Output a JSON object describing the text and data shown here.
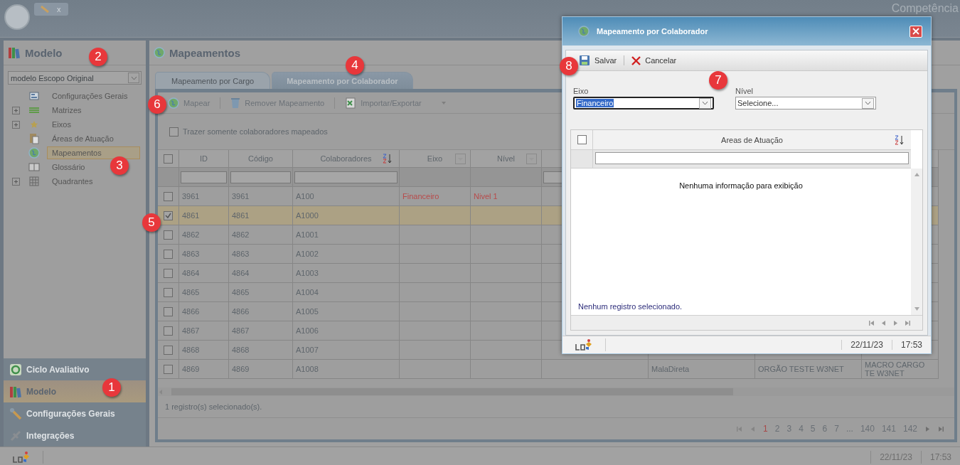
{
  "top_bar": {
    "tab_close": "x",
    "title": "Competência"
  },
  "sidebar": {
    "title": "Modelo",
    "model_select": {
      "value": "modelo Escopo Original"
    },
    "tree": [
      {
        "label": "Configurações Gerais",
        "kind": "leaf",
        "selected": false
      },
      {
        "label": "Matrizes",
        "kind": "folder",
        "selected": false
      },
      {
        "label": "Eixos",
        "kind": "folder",
        "selected": false
      },
      {
        "label": "Áreas de Atuação",
        "kind": "leaf",
        "selected": false
      },
      {
        "label": "Mapeamentos",
        "kind": "leaf",
        "selected": true
      },
      {
        "label": "Glossário",
        "kind": "leaf",
        "selected": false
      },
      {
        "label": "Quadrantes",
        "kind": "folder",
        "selected": false
      }
    ],
    "modules": [
      {
        "label": "Ciclo Avaliativo",
        "selected": false
      },
      {
        "label": "Modelo",
        "selected": true
      },
      {
        "label": "Configurações Gerais",
        "selected": false
      },
      {
        "label": "Integrações",
        "selected": false
      }
    ]
  },
  "main": {
    "title": "Mapeamentos",
    "tabs": [
      {
        "label": "Mapeamento por Cargo",
        "selected": false
      },
      {
        "label": "Mapeamento por Colaborador",
        "selected": true
      }
    ],
    "toolbar": [
      {
        "label": "Mapear",
        "kind": "button"
      },
      {
        "label": "Remover Mapeamento",
        "kind": "button"
      },
      {
        "label": "Importar/Exportar",
        "kind": "menu"
      }
    ],
    "only_mapped": {
      "label": "Trazer somente colaboradores mapeados",
      "checked": false
    },
    "table": {
      "select_all": {
        "checked": false
      },
      "columns": [
        {
          "label": "ID",
          "kind": "text"
        },
        {
          "label": "Código",
          "kind": "text"
        },
        {
          "label": "Colaboradores",
          "kind": "sorted"
        },
        {
          "label": "Eixo",
          "kind": "choice"
        },
        {
          "label": "Nível",
          "kind": "choice"
        },
        {
          "kind": "text"
        },
        {
          "kind": "plain"
        },
        {
          "kind": "plain"
        },
        {
          "kind": "plain"
        }
      ],
      "rows": [
        {
          "cells": [
            "3961",
            "3961",
            "A100",
            "Financeiro",
            "Nivel 1"
          ],
          "checked": false,
          "selected": false
        },
        {
          "cells": [
            "4861",
            "4861",
            "A1000"
          ],
          "checked": true,
          "selected": true
        },
        {
          "cells": [
            "4862",
            "4862",
            "A1001"
          ],
          "checked": false,
          "selected": false
        },
        {
          "cells": [
            "4863",
            "4863",
            "A1002"
          ],
          "checked": false,
          "selected": false
        },
        {
          "cells": [
            "4864",
            "4864",
            "A1003"
          ],
          "checked": false,
          "selected": false
        },
        {
          "cells": [
            "4865",
            "4865",
            "A1004"
          ],
          "checked": false,
          "selected": false
        },
        {
          "cells": [
            "4866",
            "4866",
            "A1005"
          ],
          "checked": false,
          "selected": false
        },
        {
          "cells": [
            "4867",
            "4867",
            "A1006"
          ],
          "checked": false,
          "selected": false
        },
        {
          "cells": [
            "4868",
            "4868",
            "A1007"
          ],
          "checked": false,
          "selected": false
        },
        {
          "cells": [
            "4869",
            "4869",
            "A1008",
            "",
            "",
            "",
            "MalaDireta",
            "ORGÃO TESTE W3NET",
            "MACRO CARGO TE W3NET"
          ],
          "checked": false,
          "selected": false
        }
      ]
    },
    "status": "1 registro(s) selecionado(s).",
    "pages": [
      {
        "label": "1",
        "selected": true
      },
      {
        "label": "2",
        "selected": false
      },
      {
        "label": "3",
        "selected": false
      },
      {
        "label": "4",
        "selected": false
      },
      {
        "label": "5",
        "selected": false
      },
      {
        "label": "6",
        "selected": false
      },
      {
        "label": "7",
        "selected": false
      },
      {
        "label": "...",
        "selected": false
      },
      {
        "label": "140",
        "selected": false
      },
      {
        "label": "141",
        "selected": false
      },
      {
        "label": "142",
        "selected": false
      }
    ]
  },
  "dialog": {
    "title": "Mapeamento por Colaborador",
    "toolbar": [
      {
        "label": "Salvar",
        "kind": "save"
      },
      {
        "label": "Cancelar",
        "kind": "cancel"
      }
    ],
    "fields": [
      {
        "label": "Eixo",
        "value": "Financeiro",
        "focused": true
      },
      {
        "label": "Nível",
        "value": "Selecione...",
        "focused": false
      }
    ],
    "grid": {
      "select_all": {
        "checked": false
      },
      "column": "Areas de Atuação",
      "empty": "Nenhuma informação para exibição",
      "status": "Nenhum registro selecionado."
    },
    "footer": {
      "date": "22/11/23",
      "time": "17:53"
    }
  },
  "status_bar": {
    "date": "22/11/23",
    "time": "17:53"
  },
  "callouts": [
    "1",
    "2",
    "3",
    "4",
    "5",
    "6",
    "7",
    "8"
  ]
}
